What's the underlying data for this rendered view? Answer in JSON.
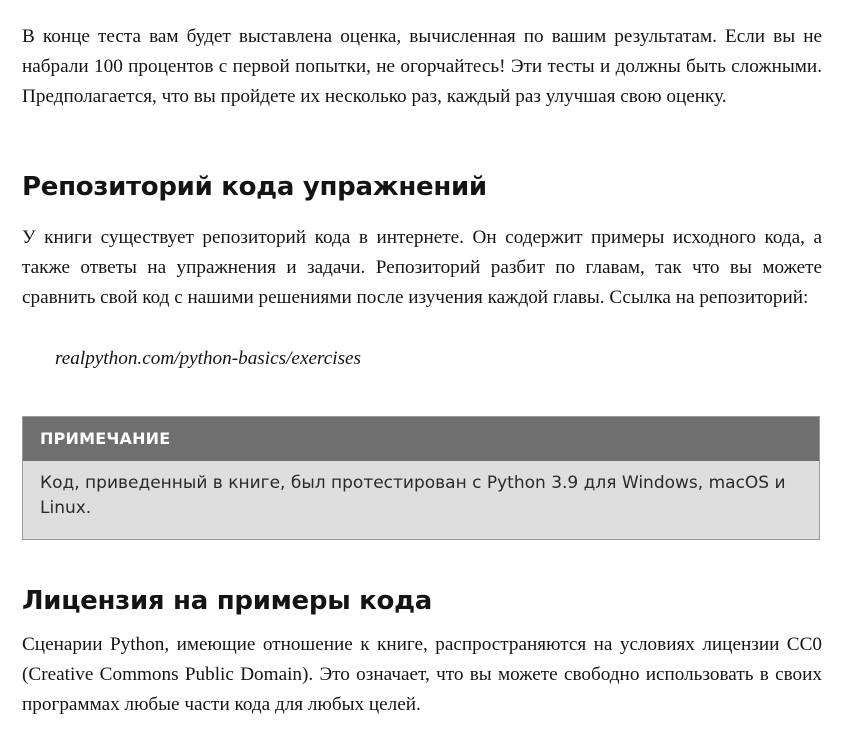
{
  "intro": {
    "paragraph": "В конце теста вам будет выставлена оценка, вычисленная по вашим результатам. Если вы не набрали 100 процентов с первой попытки, не огорчайтесь! Эти тесты и должны быть сложными. Предполагается, что вы пройдете их несколько раз, каждый раз улучшая свою оценку."
  },
  "repository": {
    "heading": "Репозиторий кода упражнений",
    "paragraph": "У книги существует репозиторий кода в интернете. Он содержит примеры исходного кода, а также ответы на упражнения и задачи. Репозиторий разбит по главам, так что вы можете сравнить свой код с нашими решениями после изучения каждой главы. Ссылка на репозиторий:",
    "link": "realpython.com/python-basics/exercises"
  },
  "note": {
    "title": "ПРИМЕЧАНИЕ",
    "text": "Код, приведенный в книге, был протестирован с Python 3.9 для Windows, macOS и Linux."
  },
  "license": {
    "heading": "Лицензия на примеры кода",
    "paragraph": "Сценарии Python, имеющие отношение к книге, распространяются на условиях лицензии CC0 (Creative Commons Public Domain). Это означает, что вы можете свободно использовать в своих программах любые части кода для любых целей."
  }
}
